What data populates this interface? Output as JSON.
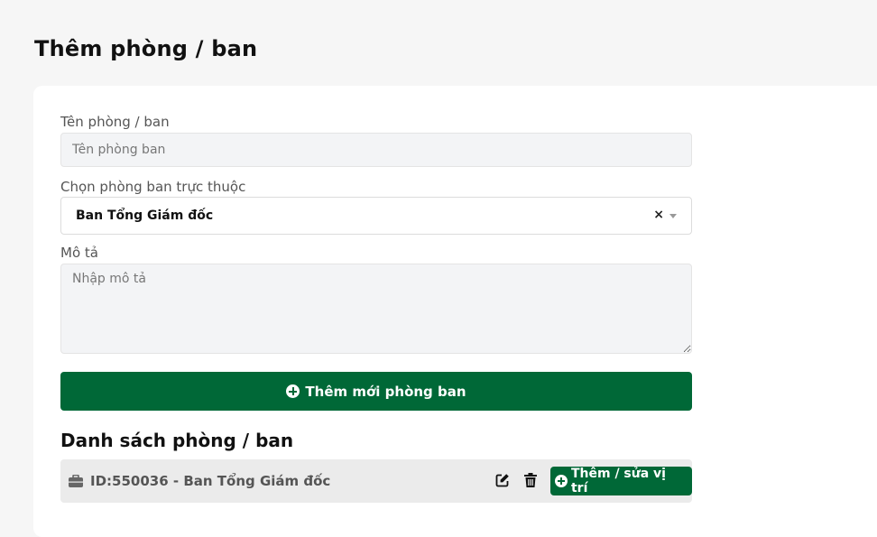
{
  "page": {
    "title": "Thêm phòng / ban"
  },
  "form": {
    "name_label": "Tên phòng / ban",
    "name_placeholder": "Tên phòng ban",
    "parent_label": "Chọn phòng ban trực thuộc",
    "parent_selected": "Ban Tổng Giám đốc",
    "parent_clear": "×",
    "description_label": "Mô tả",
    "description_placeholder": "Nhập mô tả",
    "submit_label": "Thêm mới phòng ban"
  },
  "list": {
    "title": "Danh sách phòng / ban",
    "items": [
      {
        "label": "ID:550036 - Ban Tổng Giám đốc",
        "position_button": "Thêm / sửa vị trí"
      }
    ]
  },
  "colors": {
    "primary": "#006837",
    "row_background": "#ebebeb",
    "input_background": "#f3f4f6"
  },
  "icons": {
    "submit": "plus-circle-icon",
    "row": "briefcase-icon",
    "edit": "edit-icon",
    "delete": "trash-icon",
    "position": "plus-circle-icon"
  }
}
